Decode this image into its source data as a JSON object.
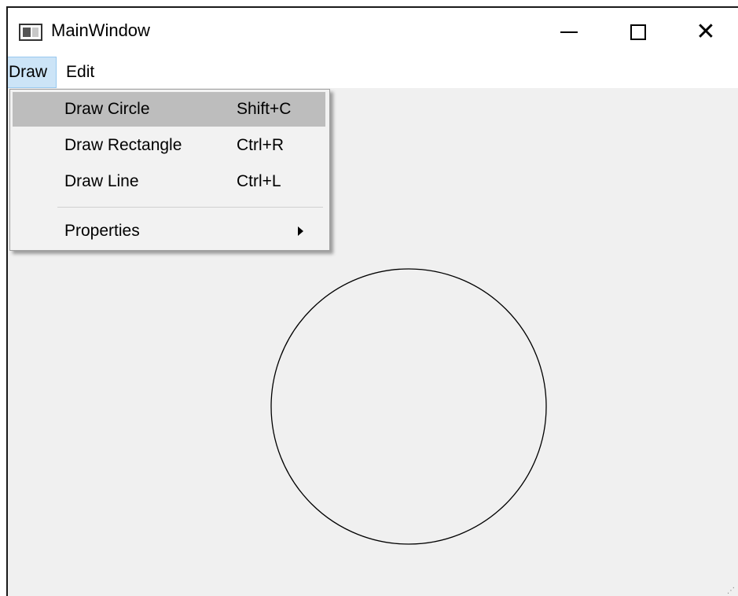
{
  "window": {
    "title": "MainWindow",
    "close_glyph": "✕"
  },
  "menubar": {
    "items": [
      {
        "label": "Draw",
        "active": true
      },
      {
        "label": "Edit",
        "active": false
      }
    ]
  },
  "draw_menu": {
    "items": [
      {
        "label": "Draw Circle",
        "shortcut": "Shift+C",
        "highlighted": true
      },
      {
        "label": "Draw Rectangle",
        "shortcut": "Ctrl+R",
        "highlighted": false
      },
      {
        "label": "Draw Line",
        "shortcut": "Ctrl+L",
        "highlighted": false
      },
      {
        "label": "Properties",
        "shortcut": "",
        "submenu": true
      }
    ]
  },
  "canvas": {
    "shapes": [
      {
        "type": "circle",
        "stroke": "#000000"
      }
    ]
  },
  "colors": {
    "canvas_bg": "#f0f0f0",
    "highlight": "#bdbdbd",
    "menubar_active": "#cce4f7"
  },
  "icons": [
    "app-window-icon",
    "minimize-icon",
    "maximize-icon",
    "close-icon",
    "submenu-arrow-icon",
    "resize-grip-icon"
  ]
}
